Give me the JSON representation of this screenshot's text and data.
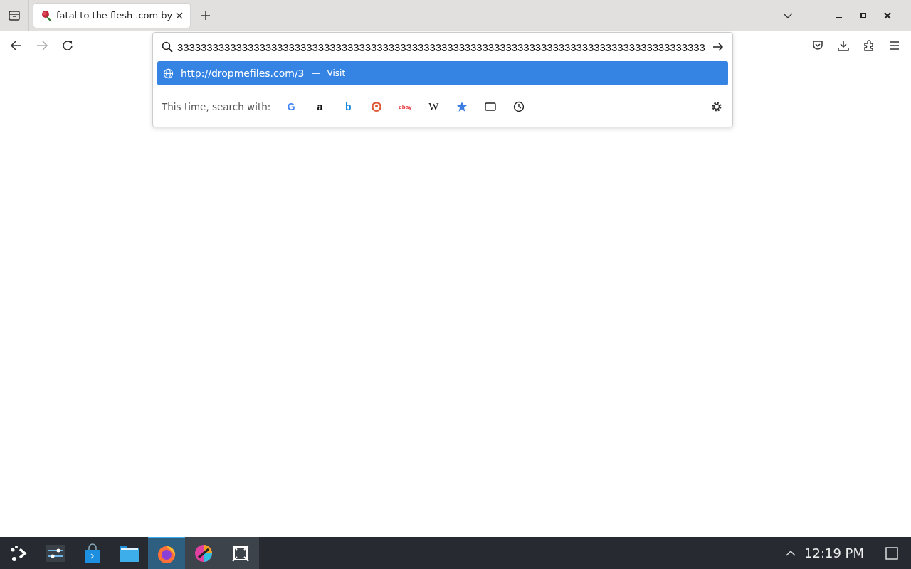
{
  "tabs": [
    {
      "title": "fatal to the flesh .com by",
      "selected": true
    }
  ],
  "address_bar": {
    "value": "333333333333333333333333333333333333333333333333333333333333333333333333333333333333333333"
  },
  "suggestions": [
    {
      "url": "http://dropmefiles.com/3",
      "separator": "—",
      "action": "Visit",
      "selected": true
    }
  ],
  "search_with": {
    "label": "This time, search with:",
    "engines": [
      {
        "kind": "google",
        "label": "G"
      },
      {
        "kind": "amazon",
        "label": "a"
      },
      {
        "kind": "bing",
        "label": "b"
      },
      {
        "kind": "duckduckgo"
      },
      {
        "kind": "ebay",
        "label": "ebay"
      },
      {
        "kind": "wikipedia",
        "label": "W"
      },
      {
        "kind": "bookmarks"
      },
      {
        "kind": "tabs"
      },
      {
        "kind": "history"
      }
    ]
  },
  "taskbar": {
    "apps": [
      {
        "kind": "launcher",
        "selected": false,
        "running": false
      },
      {
        "kind": "settings",
        "selected": false,
        "running": false
      },
      {
        "kind": "store",
        "selected": false,
        "running": false
      },
      {
        "kind": "files",
        "selected": false,
        "running": false
      },
      {
        "kind": "firefox",
        "selected": true
      },
      {
        "kind": "colorpicker",
        "selected": false,
        "running": true
      },
      {
        "kind": "screenshot",
        "selected": false,
        "running": true
      }
    ],
    "clock": "12:19 PM"
  }
}
